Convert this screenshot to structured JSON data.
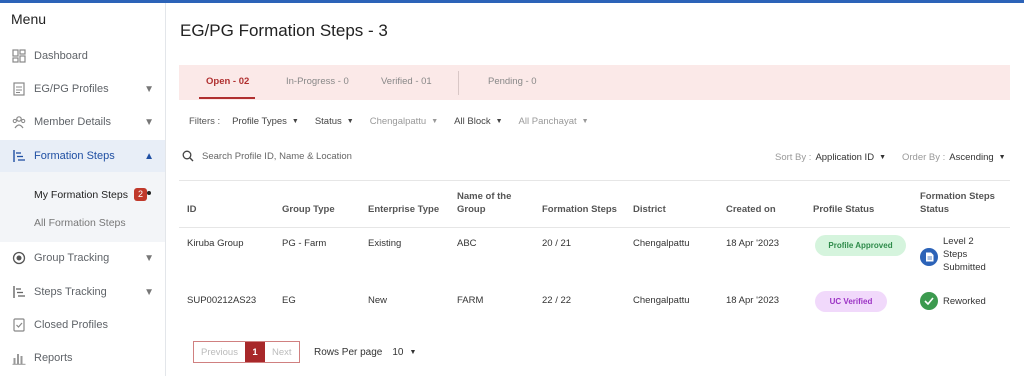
{
  "sidebar": {
    "title": "Menu",
    "items": [
      {
        "label": "Dashboard",
        "icon": "dashboard-icon"
      },
      {
        "label": "EG/PG Profiles",
        "icon": "profile-doc-icon"
      },
      {
        "label": "Member Details",
        "icon": "members-icon"
      },
      {
        "label": "Formation Steps",
        "icon": "steps-list-icon"
      },
      {
        "label": "Group Tracking",
        "icon": "tracking-icon"
      },
      {
        "label": "Steps Tracking",
        "icon": "steps-list-icon"
      },
      {
        "label": "Closed Profiles",
        "icon": "closed-doc-icon"
      },
      {
        "label": "Reports",
        "icon": "reports-icon"
      }
    ],
    "submenu": {
      "my_formation_steps": "My Formation Steps",
      "my_formation_count": "2",
      "all_formation_steps": "All Formation Steps"
    }
  },
  "page": {
    "title": "EG/PG Formation Steps -  3"
  },
  "tabs": [
    "Open - 02",
    "In-Progress - 0",
    "Verified - 01",
    "Pending - 0"
  ],
  "filters": {
    "label": "Filters :",
    "items": [
      "Profile Types",
      "Status",
      "Chengalpattu",
      "All Block",
      "All Panchayat"
    ]
  },
  "search": {
    "placeholder": "Search Profile ID, Name & Location"
  },
  "sort": {
    "sort_by_label": "Sort By :",
    "sort_by_value": "Application ID",
    "order_by_label": "Order By :",
    "order_by_value": "Ascending"
  },
  "table": {
    "headers": [
      "ID",
      "Group Type",
      "Enterprise Type",
      "Name of the Group",
      "Formation Steps",
      "District",
      "Created on",
      "Profile Status",
      "Formation Steps Status"
    ],
    "header_lines": {
      "name_1": "Name of the",
      "name_2": "Group",
      "fs_1": "Formation Steps",
      "fs_2": "Status"
    },
    "rows": [
      {
        "id": "Kiruba Group",
        "group_type": "PG - Farm",
        "enterprise_type": "Existing",
        "name": "ABC",
        "formation_steps": "20 / 21",
        "district": "Chengalpattu",
        "created_on": "18 Apr '2023",
        "profile_status": "Profile Approved",
        "fs_status_1": "Level 2",
        "fs_status_2": "Steps",
        "fs_status_3": "Submitted",
        "status_icon": "document-submitted-icon"
      },
      {
        "id": "SUP00212AS23",
        "group_type": "EG",
        "enterprise_type": "New",
        "name": "FARM",
        "formation_steps": "22 / 22",
        "district": "Chengalpattu",
        "created_on": "18 Apr '2023",
        "profile_status": "UC Verified",
        "fs_status_1": "Reworked",
        "status_icon": "check-circle-icon"
      }
    ]
  },
  "pagination": {
    "previous": "Previous",
    "page": "1",
    "next": "Next",
    "rows_per_page_label": "Rows Per page",
    "rows_per_page_value": "10"
  },
  "colors": {
    "accent": "#a8282a",
    "tab_bg": "#fbe9e8",
    "active_nav": "#1f4fa3"
  }
}
